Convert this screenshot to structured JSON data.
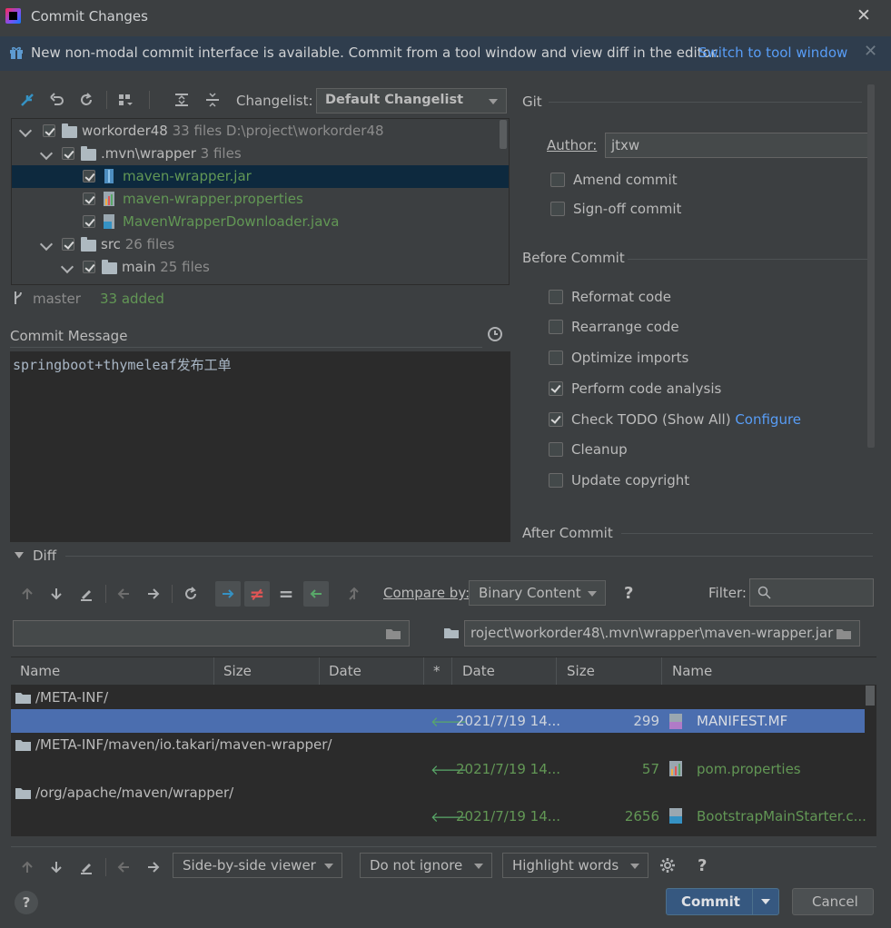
{
  "window": {
    "title": "Commit Changes"
  },
  "banner": {
    "text": "New non-modal commit interface is available. Commit from a tool window and view diff in the editor.",
    "link": "Switch to tool window"
  },
  "changes_toolbar": {
    "changelist_label": "Changelist:",
    "changelist_value": "Default Changelist"
  },
  "tree": [
    {
      "name": "workorder48",
      "meta": "33 files  D:\\project\\workorder48",
      "type": "folder",
      "checked": true
    },
    {
      "name": ".mvn\\wrapper",
      "meta": "3 files",
      "type": "folder",
      "checked": true
    },
    {
      "name": "maven-wrapper.jar",
      "meta": "",
      "type": "jar",
      "checked": true,
      "selected": true
    },
    {
      "name": "maven-wrapper.properties",
      "meta": "",
      "type": "properties",
      "checked": true
    },
    {
      "name": "MavenWrapperDownloader.java",
      "meta": "",
      "type": "java",
      "checked": true
    },
    {
      "name": "src",
      "meta": "26 files",
      "type": "folder",
      "checked": true
    },
    {
      "name": "main",
      "meta": "25 files",
      "type": "folder",
      "checked": true
    }
  ],
  "status": {
    "branch": "master",
    "added": "33 added"
  },
  "commit_message": {
    "label": "Commit Message",
    "text": "springboot+thymeleaf发布工单"
  },
  "git": {
    "title": "Git",
    "author_label": "Author:",
    "author_value": "jtxw",
    "amend": "Amend commit",
    "signoff": "Sign-off commit"
  },
  "before_commit": {
    "title": "Before Commit",
    "options": [
      {
        "label": "Reformat code",
        "checked": false
      },
      {
        "label": "Rearrange code",
        "checked": false
      },
      {
        "label": "Optimize imports",
        "checked": false
      },
      {
        "label": "Perform code analysis",
        "checked": true
      },
      {
        "label": "Check TODO (Show All)",
        "checked": true,
        "link": "Configure"
      },
      {
        "label": "Cleanup",
        "checked": false
      },
      {
        "label": "Update copyright",
        "checked": false
      }
    ]
  },
  "after_commit": {
    "title": "After Commit"
  },
  "diff": {
    "label": "Diff",
    "compare_label": "Compare by:",
    "compare_value": "Binary Content",
    "filter_label": "Filter:",
    "left_path": "",
    "right_path": "roject\\workorder48\\.mvn\\wrapper\\maven-wrapper.jar",
    "headers_left": [
      "Name",
      "Size",
      "Date"
    ],
    "header_star": "*",
    "headers_right": [
      "Date",
      "Size",
      "Name"
    ],
    "rows": [
      {
        "kind": "dir",
        "name": "/META-INF/"
      },
      {
        "kind": "file",
        "date": "2021/7/19 14...",
        "size": "299",
        "name": "MANIFEST.MF",
        "selected": true
      },
      {
        "kind": "dir",
        "name": "/META-INF/maven/io.takari/maven-wrapper/"
      },
      {
        "kind": "file",
        "date": "2021/7/19 14...",
        "size": "57",
        "name": "pom.properties"
      },
      {
        "kind": "dir",
        "name": "/org/apache/maven/wrapper/"
      },
      {
        "kind": "file",
        "date": "2021/7/19 14...",
        "size": "2656",
        "name": "BootstrapMainStarter.c..."
      }
    ],
    "viewer": "Side-by-side viewer",
    "ignore": "Do not ignore",
    "highlight": "Highlight words"
  },
  "buttons": {
    "help": "?",
    "commit": "Commit",
    "cancel": "Cancel"
  },
  "colors": {
    "background": "#3c3f41",
    "accent": "#589df6",
    "added": "#629755",
    "selection": "#4b6eaf",
    "commit_button": "#365880"
  }
}
